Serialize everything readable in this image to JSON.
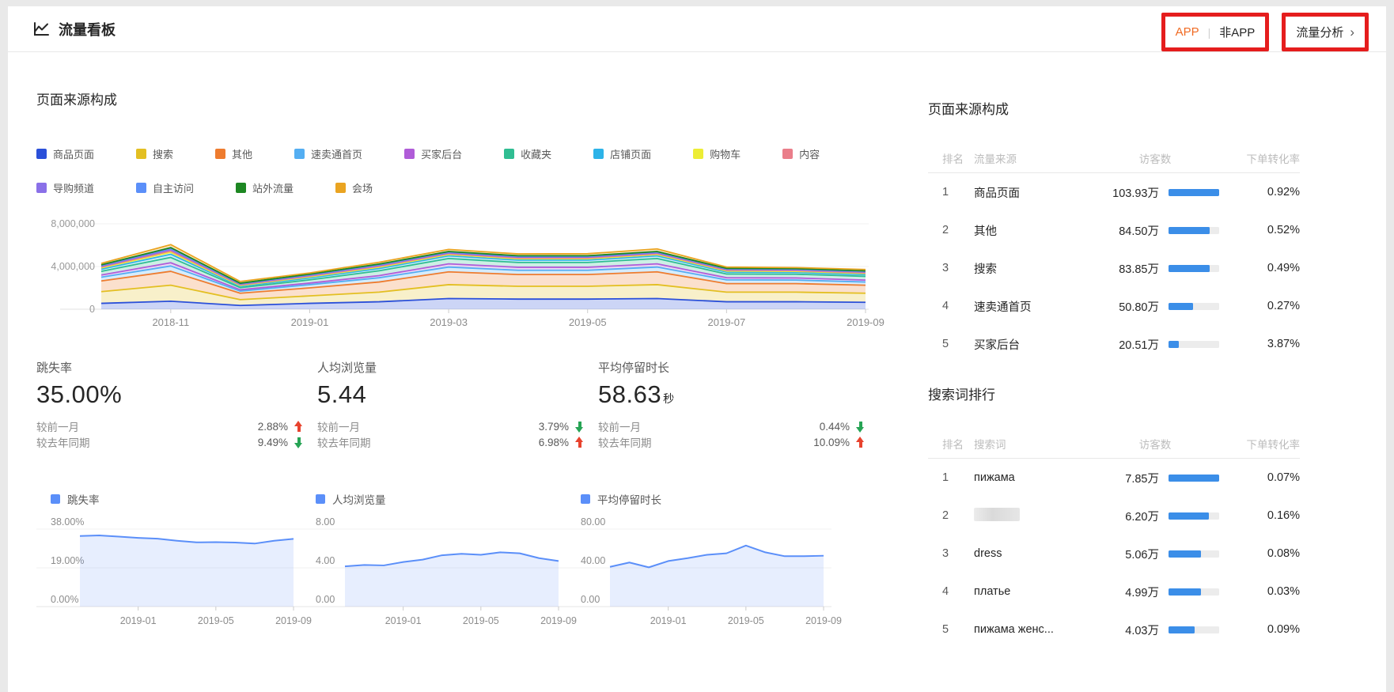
{
  "header": {
    "title": "流量看板",
    "app_toggle": {
      "divider": "|",
      "options": [
        {
          "label": "APP"
        },
        {
          "label": "非APP"
        }
      ]
    },
    "traffic_link": {
      "label": "流量分析",
      "chevron": "›"
    },
    "annotation_color": "#e51d1d"
  },
  "left": {
    "section_title": "页面来源构成",
    "kpis": [
      {
        "label": "跳失率",
        "value": "35.00%",
        "unit": "",
        "comparisons": [
          {
            "label": "较前一月",
            "value": "2.88%",
            "direction": "up",
            "color": "#e8432e"
          },
          {
            "label": "较去年同期",
            "value": "9.49%",
            "direction": "down",
            "color": "#27a455"
          }
        ]
      },
      {
        "label": "人均浏览量",
        "value": "5.44",
        "unit": "",
        "comparisons": [
          {
            "label": "较前一月",
            "value": "3.79%",
            "direction": "down",
            "color": "#27a455"
          },
          {
            "label": "较去年同期",
            "value": "6.98%",
            "direction": "up",
            "color": "#e8432e"
          }
        ]
      },
      {
        "label": "平均停留时长",
        "value": "58.63",
        "unit": "秒",
        "comparisons": [
          {
            "label": "较前一月",
            "value": "0.44%",
            "direction": "down",
            "color": "#27a455"
          },
          {
            "label": "较去年同期",
            "value": "10.09%",
            "direction": "up",
            "color": "#e8432e"
          }
        ]
      }
    ]
  },
  "right": {
    "page_source": {
      "title": "页面来源构成",
      "headers": [
        "排名",
        "流量来源",
        "访客数",
        "下单转化率"
      ],
      "rows": [
        {
          "rank": "1",
          "name": "商品页面",
          "visitors": "103.93万",
          "bar": 1.0,
          "conversion": "0.92%"
        },
        {
          "rank": "2",
          "name": "其他",
          "visitors": "84.50万",
          "bar": 0.81,
          "conversion": "0.52%"
        },
        {
          "rank": "3",
          "name": "搜索",
          "visitors": "83.85万",
          "bar": 0.81,
          "conversion": "0.49%"
        },
        {
          "rank": "4",
          "name": "速卖通首页",
          "visitors": "50.80万",
          "bar": 0.49,
          "conversion": "0.27%"
        },
        {
          "rank": "5",
          "name": "买家后台",
          "visitors": "20.51万",
          "bar": 0.2,
          "conversion": "3.87%"
        }
      ]
    },
    "search_terms": {
      "title": "搜索词排行",
      "headers": [
        "排名",
        "搜索词",
        "访客数",
        "下单转化率"
      ],
      "rows": [
        {
          "rank": "1",
          "name": "пижама",
          "visitors": "7.85万",
          "bar": 1.0,
          "conversion": "0.07%"
        },
        {
          "rank": "2",
          "name": "",
          "redacted": true,
          "visitors": "6.20万",
          "bar": 0.79,
          "conversion": "0.16%"
        },
        {
          "rank": "3",
          "name": "dress",
          "visitors": "5.06万",
          "bar": 0.64,
          "conversion": "0.08%"
        },
        {
          "rank": "4",
          "name": "платье",
          "visitors": "4.99万",
          "bar": 0.64,
          "conversion": "0.03%"
        },
        {
          "rank": "5",
          "name": "пижама женс...",
          "visitors": "4.03万",
          "bar": 0.51,
          "conversion": "0.09%"
        }
      ]
    }
  },
  "chart_data": [
    {
      "type": "area",
      "stacked": true,
      "title": "页面来源构成",
      "x": [
        "2018-10",
        "2018-11",
        "2018-12",
        "2019-01",
        "2019-02",
        "2019-03",
        "2019-04",
        "2019-05",
        "2019-06",
        "2019-07",
        "2019-08",
        "2019-09"
      ],
      "x_tick_indices": [
        1,
        3,
        5,
        7,
        9,
        11
      ],
      "x_tick_labels": [
        "2018-11",
        "2019-01",
        "2019-03",
        "2019-05",
        "2019-07",
        "2019-09"
      ],
      "y_ticks": [
        "0",
        "4,000,000",
        "8,000,000"
      ],
      "ylim": [
        0,
        8000000
      ],
      "grid": true,
      "legend_position": "top",
      "legend_rows": [
        9,
        4
      ],
      "series": [
        {
          "name": "商品页面",
          "color": "#2b50d9",
          "values": [
            550000,
            750000,
            350000,
            550000,
            700000,
            1000000,
            950000,
            950000,
            1000000,
            700000,
            700000,
            650000
          ]
        },
        {
          "name": "搜索",
          "color": "#e3bf22",
          "values": [
            1100000,
            1500000,
            550000,
            700000,
            900000,
            1300000,
            1200000,
            1200000,
            1300000,
            900000,
            900000,
            850000
          ]
        },
        {
          "name": "其他",
          "color": "#ee7c2f",
          "values": [
            1000000,
            1300000,
            600000,
            750000,
            950000,
            1200000,
            1100000,
            1100000,
            1200000,
            800000,
            800000,
            750000
          ]
        },
        {
          "name": "速卖通首页",
          "color": "#54aef2",
          "values": [
            350000,
            500000,
            200000,
            300000,
            400000,
            450000,
            400000,
            400000,
            450000,
            350000,
            330000,
            300000
          ]
        },
        {
          "name": "买家后台",
          "color": "#b05cd8",
          "values": [
            200000,
            300000,
            120000,
            150000,
            200000,
            300000,
            280000,
            280000,
            300000,
            200000,
            200000,
            180000
          ]
        },
        {
          "name": "收藏夹",
          "color": "#30bd92",
          "values": [
            350000,
            500000,
            200000,
            300000,
            450000,
            500000,
            450000,
            450000,
            500000,
            350000,
            350000,
            350000
          ]
        },
        {
          "name": "店铺页面",
          "color": "#2db3e8",
          "values": [
            200000,
            300000,
            120000,
            180000,
            220000,
            250000,
            220000,
            220000,
            250000,
            180000,
            170000,
            160000
          ]
        },
        {
          "name": "购物车",
          "color": "#eded35",
          "values": [
            120000,
            180000,
            80000,
            100000,
            120000,
            120000,
            120000,
            120000,
            120000,
            100000,
            100000,
            100000
          ]
        },
        {
          "name": "内容",
          "color": "#ea7e8a",
          "values": [
            80000,
            120000,
            60000,
            70000,
            80000,
            80000,
            80000,
            80000,
            80000,
            70000,
            70000,
            70000
          ]
        },
        {
          "name": "导购频道",
          "color": "#8a70e8",
          "values": [
            80000,
            120000,
            60000,
            70000,
            80000,
            80000,
            80000,
            80000,
            80000,
            70000,
            70000,
            70000
          ]
        },
        {
          "name": "自主访问",
          "color": "#5b8ff9",
          "values": [
            80000,
            120000,
            60000,
            70000,
            80000,
            80000,
            80000,
            80000,
            80000,
            70000,
            70000,
            70000
          ]
        },
        {
          "name": "站外流量",
          "color": "#1d8722",
          "values": [
            50000,
            80000,
            40000,
            50000,
            50000,
            50000,
            50000,
            50000,
            50000,
            40000,
            40000,
            40000
          ]
        },
        {
          "name": "会场",
          "color": "#eaa421",
          "values": [
            140000,
            280000,
            160000,
            110000,
            170000,
            190000,
            170000,
            190000,
            240000,
            120000,
            100000,
            130000
          ]
        }
      ]
    },
    {
      "type": "area",
      "title": "跳失率",
      "color": "#5b8ff9",
      "x": [
        "2018-10",
        "2018-11",
        "2018-12",
        "2019-01",
        "2019-02",
        "2019-03",
        "2019-04",
        "2019-05",
        "2019-06",
        "2019-07",
        "2019-08",
        "2019-09"
      ],
      "x_tick_indices": [
        3,
        7,
        11
      ],
      "x_tick_labels": [
        "2019-01",
        "2019-05",
        "2019-09"
      ],
      "y_ticks": [
        "0.00%",
        "19.00%",
        "38.00%"
      ],
      "ylim": [
        0,
        38
      ],
      "grid": true,
      "values": [
        34.6,
        34.9,
        34.3,
        33.7,
        33.3,
        32.3,
        31.5,
        31.6,
        31.4,
        30.9,
        32.3,
        33.2
      ]
    },
    {
      "type": "area",
      "title": "人均浏览量",
      "color": "#5b8ff9",
      "x": [
        "2018-10",
        "2018-11",
        "2018-12",
        "2019-01",
        "2019-02",
        "2019-03",
        "2019-04",
        "2019-05",
        "2019-06",
        "2019-07",
        "2019-08",
        "2019-09"
      ],
      "x_tick_indices": [
        3,
        7,
        11
      ],
      "x_tick_labels": [
        "2019-01",
        "2019-05",
        "2019-09"
      ],
      "y_ticks": [
        "0.00",
        "4.00",
        "8.00"
      ],
      "ylim": [
        0,
        8
      ],
      "grid": true,
      "values": [
        4.15,
        4.3,
        4.25,
        4.6,
        4.85,
        5.3,
        5.45,
        5.35,
        5.6,
        5.5,
        5.0,
        4.7
      ]
    },
    {
      "type": "area",
      "title": "平均停留时长",
      "color": "#5b8ff9",
      "x": [
        "2018-10",
        "2018-11",
        "2018-12",
        "2019-01",
        "2019-02",
        "2019-03",
        "2019-04",
        "2019-05",
        "2019-06",
        "2019-07",
        "2019-08",
        "2019-09"
      ],
      "x_tick_indices": [
        3,
        7,
        11
      ],
      "x_tick_labels": [
        "2019-01",
        "2019-05",
        "2019-09"
      ],
      "y_ticks": [
        "0.00",
        "40.00",
        "80.00"
      ],
      "ylim": [
        0,
        80
      ],
      "grid": true,
      "values": [
        41,
        45.5,
        40.5,
        47,
        50,
        53.5,
        55,
        63,
        56,
        52,
        52,
        52.5
      ]
    }
  ]
}
